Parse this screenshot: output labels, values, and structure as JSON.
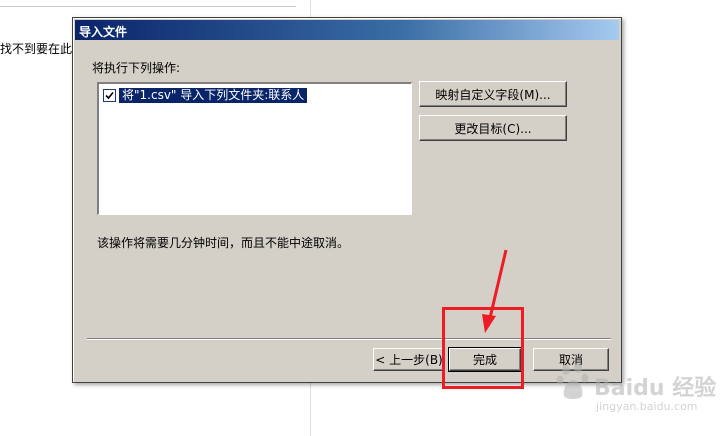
{
  "background": {
    "top_text": "...",
    "left_text": "找不到要在此"
  },
  "dialog": {
    "title": "导入文件",
    "operations_label": "将执行下列操作:",
    "list_items": [
      {
        "label": "将\"1.csv\" 导入下列文件夹:联系人",
        "checked": true
      }
    ],
    "map_fields_button": "映射自定义字段(M)...",
    "change_target_button": "更改目标(C)...",
    "note": "该操作将需要几分钟时间，而且不能中途取消。",
    "back_button": "< 上一步(B)",
    "finish_button": "完成",
    "cancel_button": "取消"
  },
  "watermark": {
    "brand": "Baidu 经验",
    "url": "jingyan.baidu.com"
  },
  "colors": {
    "dialog_bg": "#d4d0c8",
    "title_start": "#0a246a",
    "selection": "#0a246a",
    "highlight": "#ee1c24"
  }
}
